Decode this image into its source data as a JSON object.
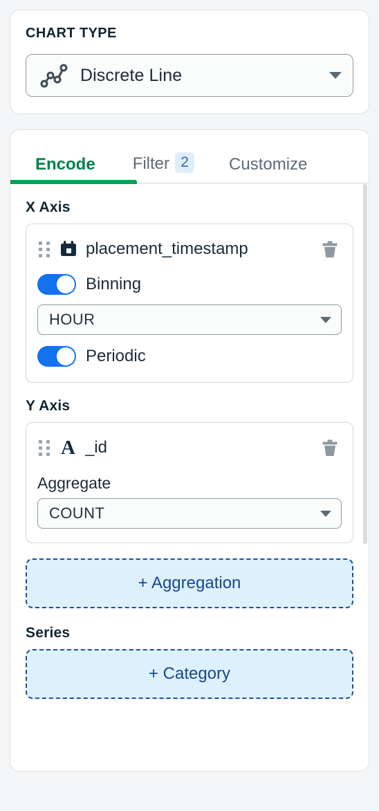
{
  "chart_type_panel": {
    "title": "CHART TYPE",
    "selected": "Discrete Line",
    "icon": "line-chart-icon",
    "caret": "chevron-down-icon"
  },
  "tabs": [
    {
      "label": "Encode",
      "active": true,
      "badge": null
    },
    {
      "label": "Filter",
      "active": false,
      "badge": "2"
    },
    {
      "label": "Customize",
      "active": false,
      "badge": null
    }
  ],
  "encode": {
    "x_axis": {
      "label": "X Axis",
      "field": {
        "name": "placement_timestamp",
        "type_icon": "calendar-icon",
        "drag_handle": "drag-handle-icon",
        "delete_icon": "trash-icon"
      },
      "binning": {
        "label": "Binning",
        "enabled": true,
        "unit": "HOUR"
      },
      "periodic": {
        "label": "Periodic",
        "enabled": true
      }
    },
    "y_axis": {
      "label": "Y Axis",
      "field": {
        "name": "_id",
        "type_icon": "string-field-icon",
        "type_glyph": "A",
        "drag_handle": "drag-handle-icon",
        "delete_icon": "trash-icon"
      },
      "aggregate": {
        "label": "Aggregate",
        "value": "COUNT"
      }
    },
    "add_aggregation_label": "+ Aggregation",
    "series": {
      "label": "Series",
      "add_category_label": "+ Category"
    }
  },
  "colors": {
    "page_background": "#f4f5f6",
    "card_background": "#ffffff",
    "accent_green": "#00a056",
    "active_tab_text": "#00814a",
    "toggle_on_blue": "#1272ef",
    "dashed_button_fill": "#ddf1fd",
    "dashed_button_border": "#1b4f9c",
    "dashed_button_text": "#18468e",
    "badge_background": "#ddeefc",
    "badge_text": "#3167b5",
    "heading_text": "#0f2533",
    "muted_text": "#5d6b75"
  }
}
